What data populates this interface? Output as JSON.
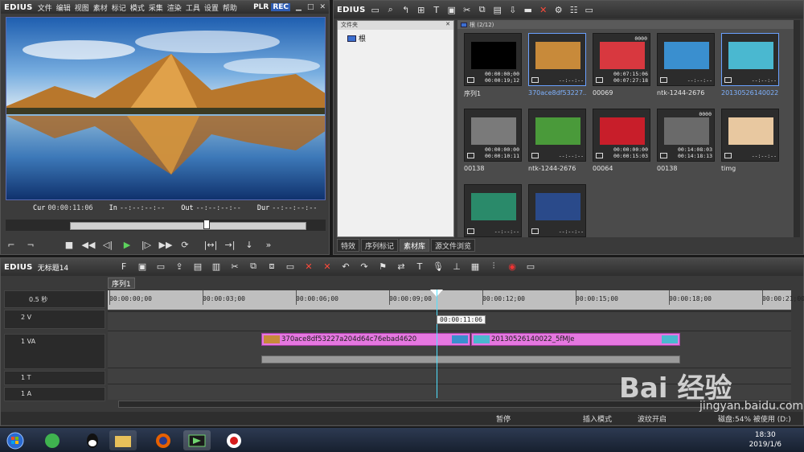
{
  "player": {
    "logo": "EDIUS",
    "menu": [
      "文件",
      "编辑",
      "视图",
      "素材",
      "标记",
      "模式",
      "采集",
      "渲染",
      "工具",
      "设置",
      "帮助"
    ],
    "plr": "PLR",
    "rec": "REC",
    "cur_label": "Cur",
    "cur_value": "00:00:11:06",
    "in_label": "In",
    "in_value": "--:--:--:--",
    "out_label": "Out",
    "out_value": "--:--:--:--",
    "dur_label": "Dur",
    "dur_value": "--:--:--:--",
    "scrub_position": 0.58
  },
  "bin": {
    "logo": "EDIUS",
    "folder_header": "文件夹",
    "root_folder": "根",
    "clip_header": "根 (2/12)",
    "tabs": [
      "特效",
      "序列标记",
      "素材库",
      "源文件浏览"
    ],
    "active_tab": 2,
    "clips": [
      {
        "name": "序列1",
        "tc1": "00:00:00;00",
        "tc2": "00:00:19;12",
        "badge": "",
        "color": "#000000",
        "icon": "sequence-icon"
      },
      {
        "name": "370ace8df53227...",
        "tc1": "--:--:--",
        "tc2": "",
        "badge": "",
        "color": "#c88a3a",
        "icon": "photo-icon",
        "selected": true
      },
      {
        "name": "00069",
        "tc1": "00:07:15:06",
        "tc2": "00:07:27:18",
        "badge": "",
        "color": "#d8383f",
        "icon": "video-icon"
      },
      {
        "name": "ntk-1244-2676",
        "tc1": "--:--:--",
        "tc2": "",
        "badge": "",
        "color": "#3a8fcf",
        "icon": "photo-icon"
      },
      {
        "name": "20130526140022...",
        "tc1": "--:--:--",
        "tc2": "",
        "badge": "",
        "color": "#4ab8d0",
        "icon": "photo-icon",
        "selected": true
      },
      {
        "name": "00138",
        "tc1": "00:00:00:00",
        "tc2": "00:00:10:11",
        "badge": "",
        "color": "#7a7a7a",
        "icon": "video-icon"
      },
      {
        "name": "ntk-1244-2676",
        "tc1": "--:--:--",
        "tc2": "",
        "badge": "",
        "color": "#4a9a3a",
        "icon": "photo-icon"
      },
      {
        "name": "00064",
        "tc1": "00:00:00:00",
        "tc2": "00:00:15:03",
        "badge": "",
        "color": "#c81e2a",
        "icon": "video-icon"
      },
      {
        "name": "00138",
        "tc1": "00:14:08:03",
        "tc2": "00:14:18:13",
        "badge": "0000",
        "color": "#6a6a6a",
        "icon": "video-icon"
      },
      {
        "name": "timg",
        "tc1": "--:--:--",
        "tc2": "",
        "badge": "",
        "color": "#e8c8a0",
        "icon": "photo-icon"
      },
      {
        "name": "",
        "tc1": "--:--:--",
        "tc2": "",
        "badge": "",
        "color": "#2a8a6a",
        "icon": "photo-icon"
      },
      {
        "name": "",
        "tc1": "--:--:--",
        "tc2": "",
        "badge": "",
        "color": "#2a4a8a",
        "icon": "photo-icon"
      }
    ],
    "badge_00069": "0000"
  },
  "timeline": {
    "logo": "EDIUS",
    "project": "无标题14",
    "sequence_tab": "序列1",
    "zoom": "0.5 秒",
    "ruler_ticks": [
      "00:00:00;00",
      "00:00:03;00",
      "00:00:06;00",
      "00:00:09;00",
      "00:00:12;00",
      "00:00:15;00",
      "00:00:18;00",
      "00:00:21;00"
    ],
    "tracks": [
      {
        "label": "2 V"
      },
      {
        "label": "1 VA"
      },
      {
        "label": "1 T"
      },
      {
        "label": "1 A"
      }
    ],
    "clip1": "370ace8df53227a204d64c76ebad4620",
    "clip2": "20130526140022_5fMJe",
    "playhead_tc": "00:00:11:06"
  },
  "status": {
    "pause": "暂停",
    "insert_mode": "插入模式",
    "ripple": "波纹开启",
    "disk": "磁盘:54% 被使用 (D:)"
  },
  "taskbar": {
    "time": "18:30",
    "date": "2019/1/6"
  },
  "watermark": {
    "brand": "Bai 经验",
    "url": "jingyan.baidu.com"
  }
}
